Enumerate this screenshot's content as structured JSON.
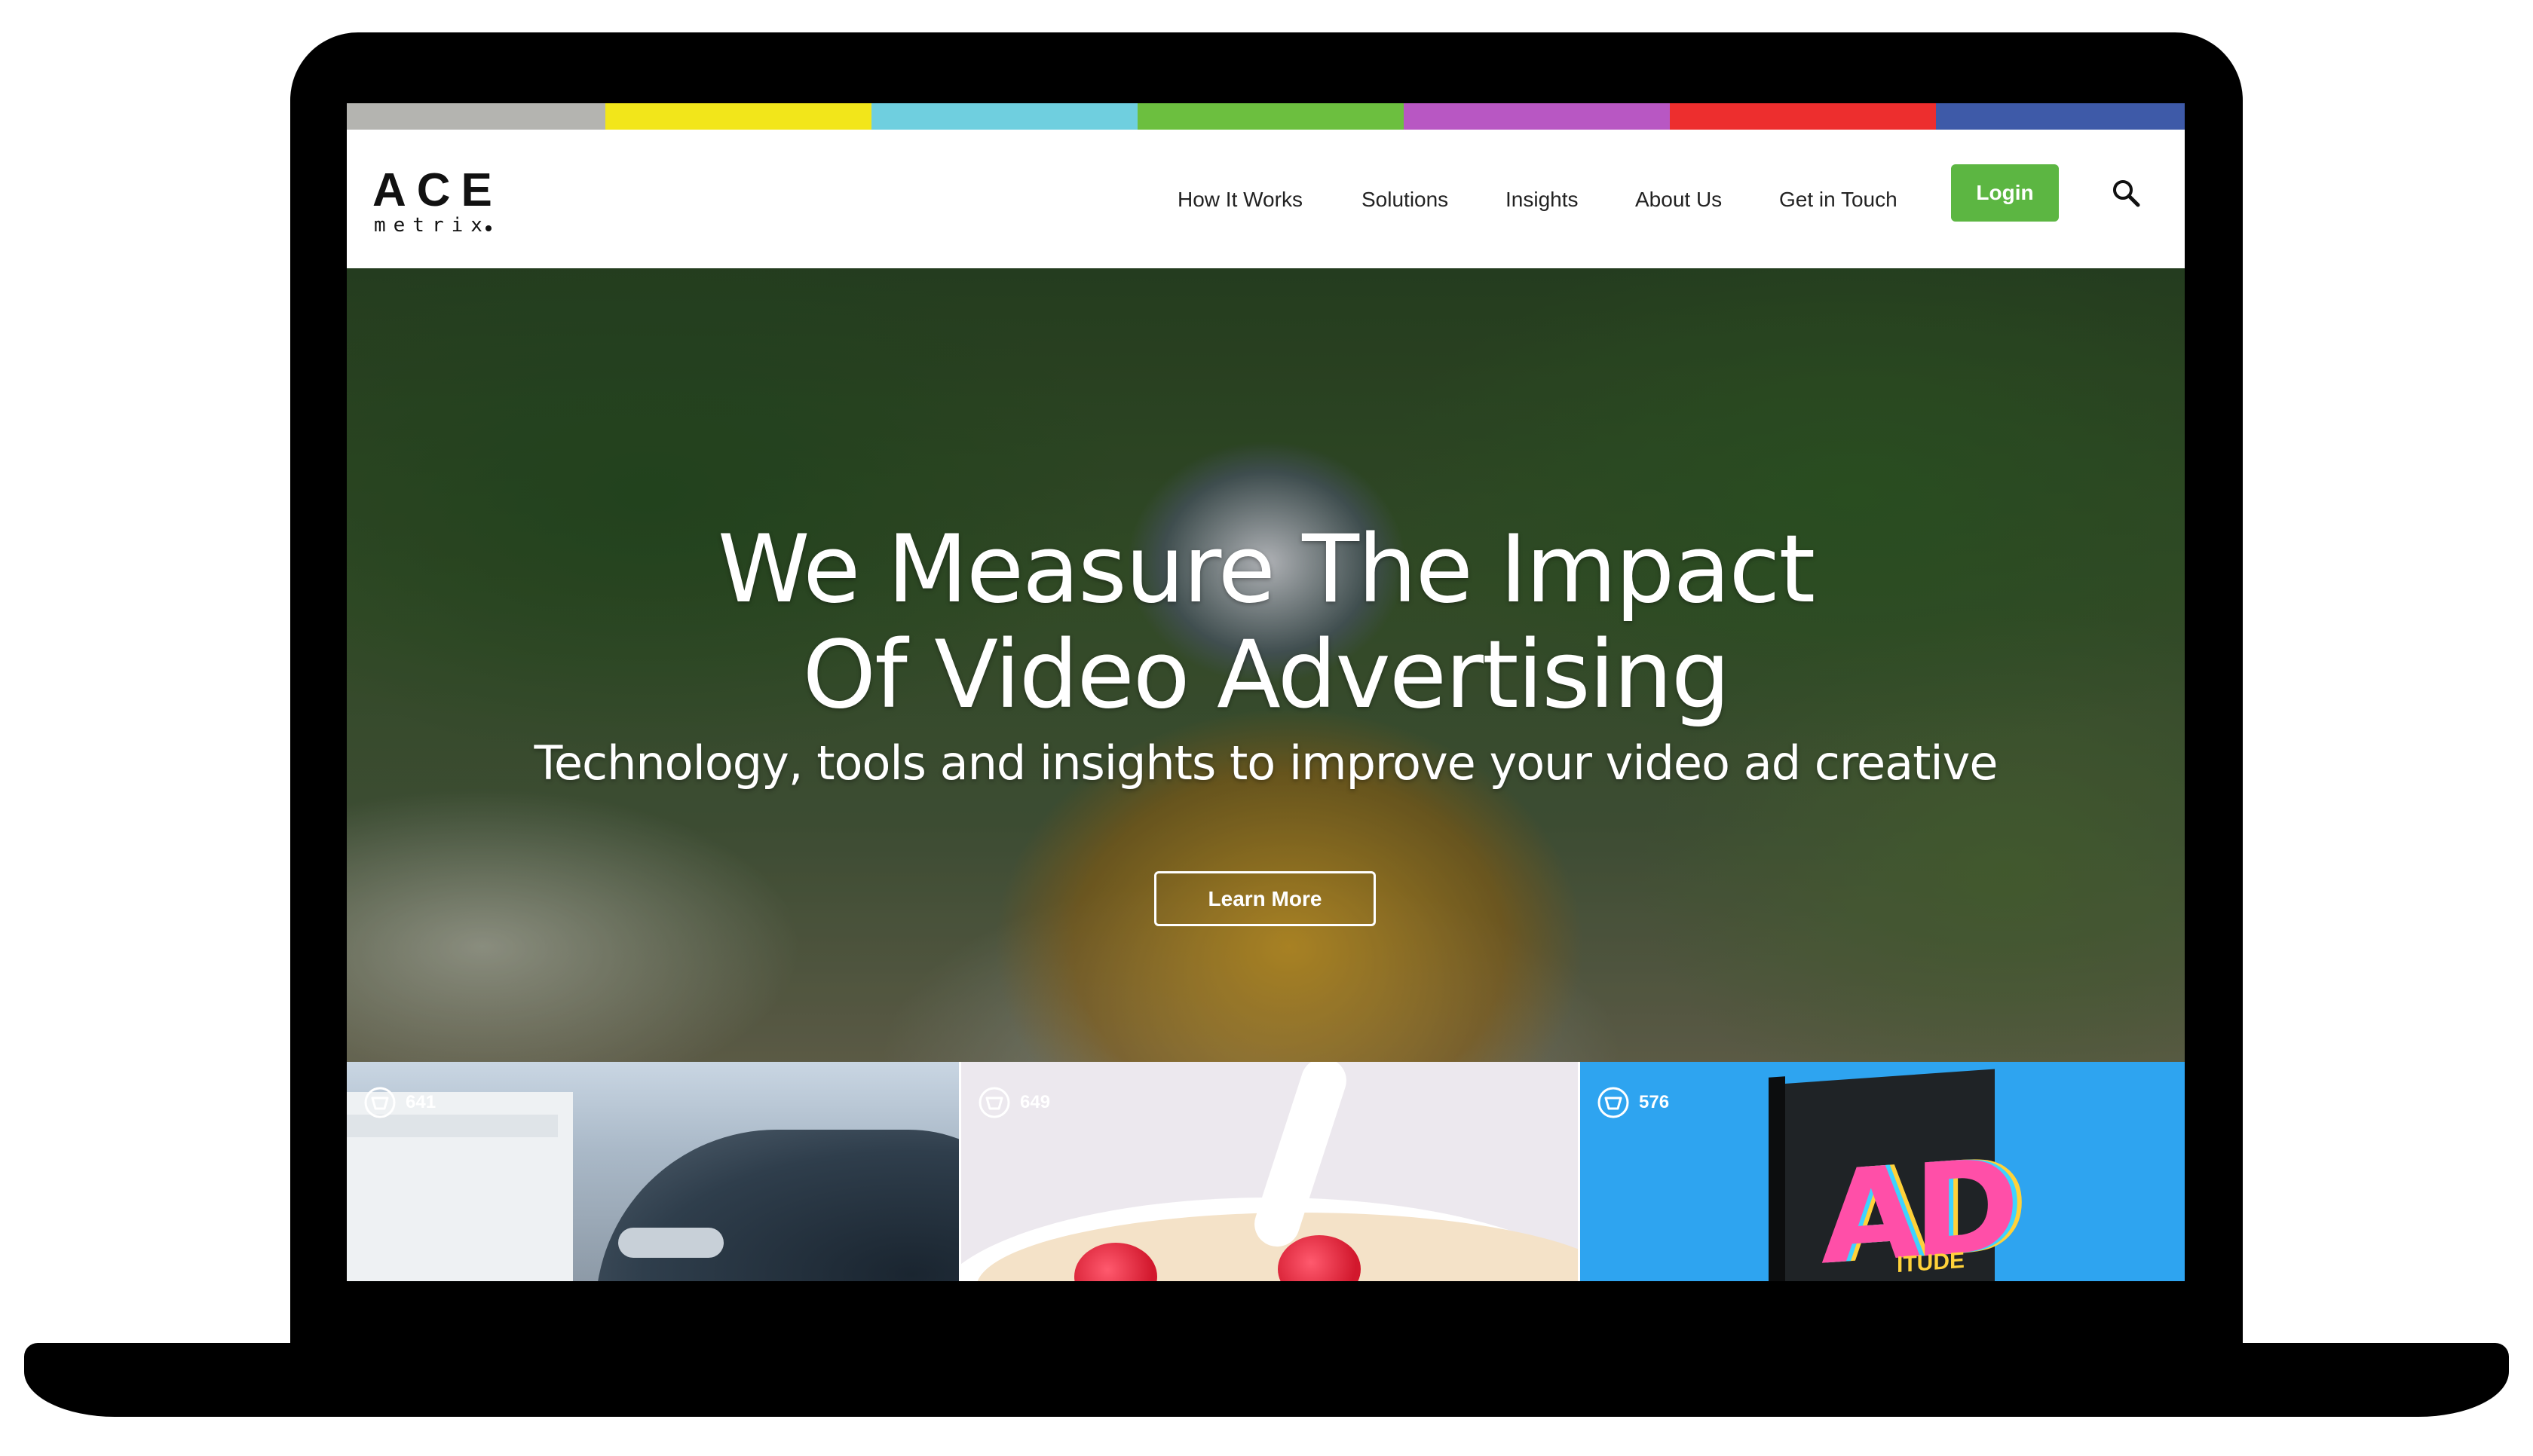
{
  "brand": {
    "logo_top": "ACE",
    "logo_bottom": "metrix",
    "strip_colors": [
      "#b4b4b0",
      "#f2e61a",
      "#6fcfdf",
      "#6cbf3f",
      "#b857c3",
      "#ed2e2e",
      "#3e5aa8"
    ],
    "accent": "#5cb642"
  },
  "nav": {
    "items": [
      "How It Works",
      "Solutions",
      "Insights",
      "About Us",
      "Get in Touch"
    ],
    "login_label": "Login",
    "search_icon": "search-icon"
  },
  "hero": {
    "title_line1": "We Measure The Impact",
    "title_line2": "Of Video Advertising",
    "subtitle": "Technology, tools and insights to improve your video ad creative",
    "cta_label": "Learn More"
  },
  "tiles": [
    {
      "score": "641"
    },
    {
      "score": "649"
    },
    {
      "score": "576"
    }
  ],
  "tile_art": {
    "book_text": "AD",
    "book_subtext": "ITUDE"
  }
}
